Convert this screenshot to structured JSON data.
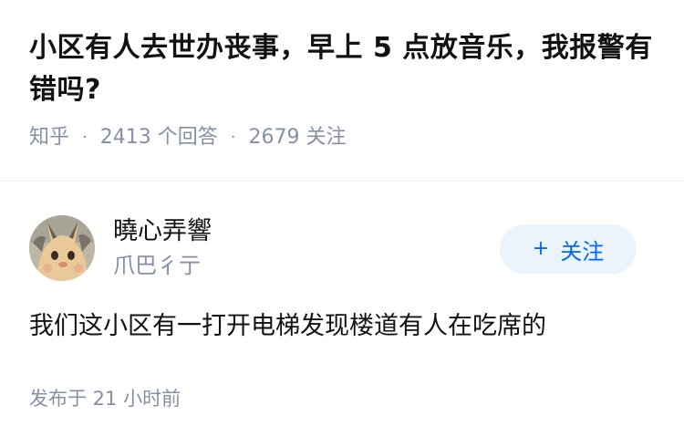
{
  "question": {
    "title": "小区有人去世办丧事，早上 5 点放音乐，我报警有错吗?",
    "source": "知乎",
    "answers_count": "2413 个回答",
    "followers_count": "2679 关注",
    "separator": "·"
  },
  "answer": {
    "author": {
      "name": "曉心弄響",
      "bio": "爪巴彳亍"
    },
    "follow_button": {
      "icon": "+",
      "label": "关注"
    },
    "content": "我们这小区有一打开电梯发现楼道有人在吃席的",
    "published": "发布于 21 小时前"
  },
  "colors": {
    "text_primary": "#121212",
    "text_secondary": "#8590a6",
    "accent_blue": "#0066ff",
    "follow_bg": "#ebf3fb"
  }
}
